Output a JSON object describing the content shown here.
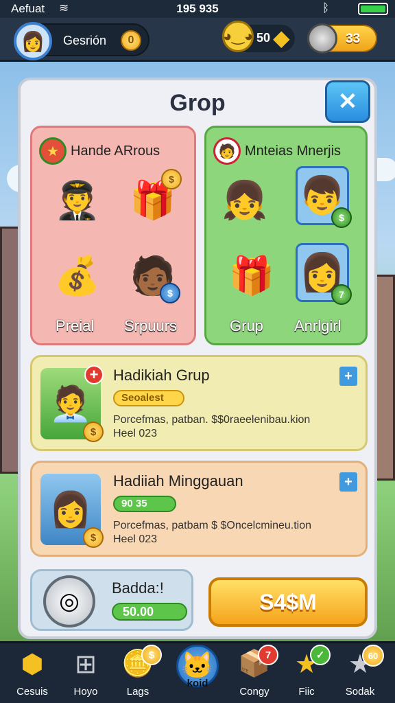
{
  "status_bar": {
    "carrier": "Aefuat",
    "time": "195 935"
  },
  "hud": {
    "profile_name": "Gesrión",
    "profile_coin": "0",
    "gem_count": "50",
    "silver_count": "33"
  },
  "panel": {
    "title": "Grop",
    "close_label": "✕",
    "card_left": {
      "title": "Hande ARrous",
      "label_left": "Preial",
      "label_right": "Srpuurs",
      "coin_badge": "$",
      "blue_badge": "$"
    },
    "card_right": {
      "title": "Mnteias Mnerjis",
      "label_left": "Grup",
      "label_right": "Anrlgirl",
      "badge_top": "$",
      "badge_bottom": "7"
    },
    "reward_1": {
      "title": "Hadikiah Grup",
      "tag": "Seoalest",
      "desc_line1": "Porcefmas, patban. $$0raeelenibau.kion",
      "desc_line2": "Heel 023",
      "corner_mark": "+"
    },
    "reward_2": {
      "title": "Hadiiah Minggauan",
      "tag": "90 35",
      "desc_line1": "Porcefmas, patbam $ $Oncelcmineu.tion",
      "desc_line2": "Heel 023",
      "corner_mark": "+"
    },
    "badge": {
      "title": "Badda:!",
      "value": "50.00"
    },
    "claim_label": "S4$M"
  },
  "bottom_nav": [
    {
      "label": "Cesuis",
      "badge": ""
    },
    {
      "label": "Hoyo",
      "badge": ""
    },
    {
      "label": "Lags",
      "badge": "$"
    },
    {
      "label": "koid",
      "badge": ""
    },
    {
      "label": "Congy",
      "badge": "7"
    },
    {
      "label": "Fiic",
      "badge": "✓"
    },
    {
      "label": "Sodak",
      "badge": "60"
    }
  ]
}
